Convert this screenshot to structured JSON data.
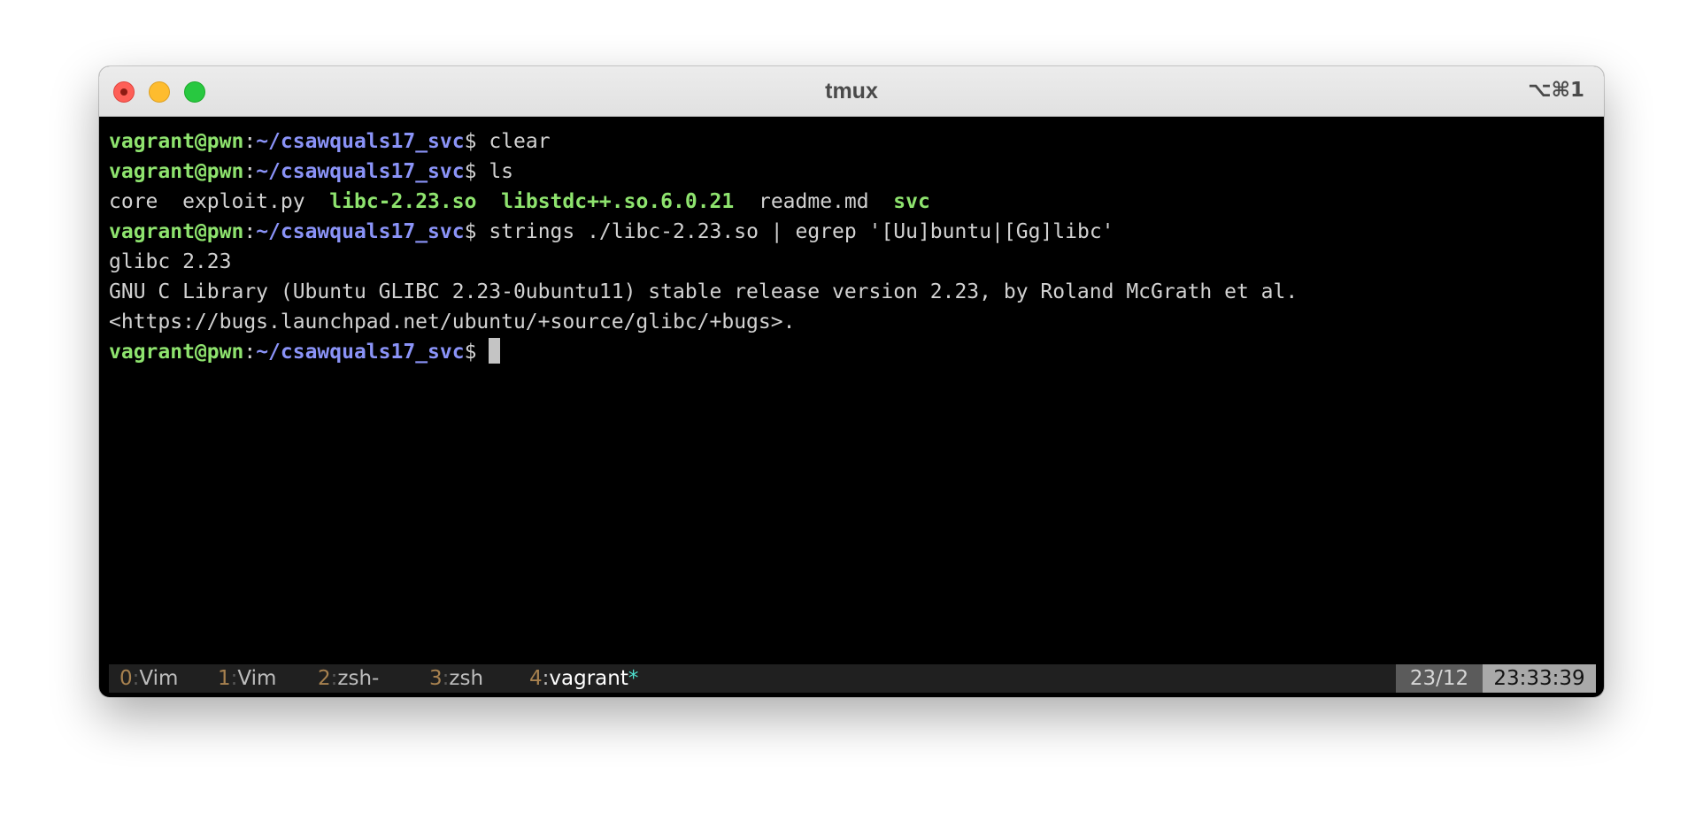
{
  "window": {
    "title": "tmux",
    "shortcut": "⌥⌘1"
  },
  "colors": {
    "user_host": "#8ee36e",
    "path": "#8a93f7",
    "text": "#d2d2d2",
    "executable": "#8ee36e",
    "status_bar_bg": "#202020",
    "window_index": "#a7814f",
    "window_flag": "#4fe0cf"
  },
  "terminal": {
    "prompt": {
      "user_host": "vagrant@pwn",
      "colon": ":",
      "path": "~/csawquals17_svc",
      "symbol": "$"
    },
    "commands": [
      "clear",
      "ls",
      "strings ./libc-2.23.so | egrep '[Uu]buntu|[Gg]libc'"
    ],
    "ls_output": [
      {
        "name": "core",
        "executable": false
      },
      {
        "name": "exploit.py",
        "executable": false
      },
      {
        "name": "libc-2.23.so",
        "executable": true
      },
      {
        "name": "libstdc++.so.6.0.21",
        "executable": true
      },
      {
        "name": "readme.md",
        "executable": false
      },
      {
        "name": "svc",
        "executable": true
      }
    ],
    "strings_output": [
      "glibc 2.23",
      "GNU C Library (Ubuntu GLIBC 2.23-0ubuntu11) stable release version 2.23, by Roland McGrath et al.",
      "<https://bugs.launchpad.net/ubuntu/+source/glibc/+bugs>."
    ]
  },
  "statusbar": {
    "windows": [
      {
        "index": "0",
        "sep": ":",
        "name": "Vim",
        "flag": ""
      },
      {
        "index": "1",
        "sep": ":",
        "name": "Vim",
        "flag": ""
      },
      {
        "index": "2",
        "sep": ":",
        "name": "zsh-",
        "flag": ""
      },
      {
        "index": "3",
        "sep": ":",
        "name": "zsh",
        "flag": ""
      },
      {
        "index": "4",
        "sep": ":",
        "name": "vagrant",
        "flag": "*"
      }
    ],
    "load": "23/12",
    "time": "23:33:39"
  }
}
